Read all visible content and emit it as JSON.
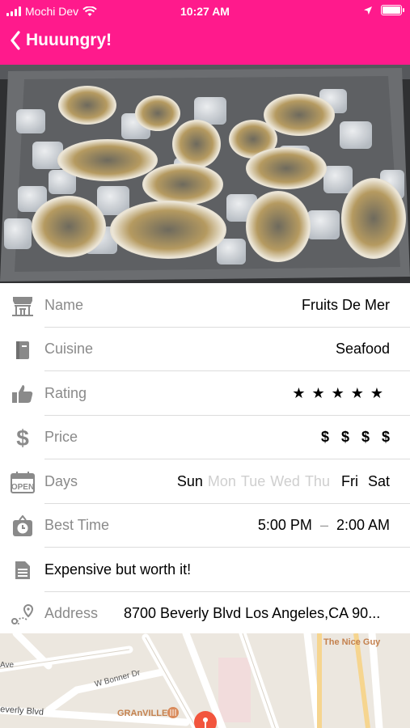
{
  "status_bar": {
    "carrier": "Mochi Dev",
    "time": "10:27 AM"
  },
  "nav": {
    "title": "Huuungry!"
  },
  "details": {
    "name_label": "Name",
    "name_value": "Fruits De Mer",
    "cuisine_label": "Cuisine",
    "cuisine_value": "Seafood",
    "rating_label": "Rating",
    "rating_stars": "★★★★★",
    "rating_value": 5,
    "price_label": "Price",
    "price_symbols": [
      "$",
      "$",
      "$",
      "$"
    ],
    "days_label": "Days",
    "days": [
      {
        "label": "Sun",
        "active": true
      },
      {
        "label": "Mon",
        "active": false
      },
      {
        "label": "Tue",
        "active": false
      },
      {
        "label": "Wed",
        "active": false
      },
      {
        "label": "Thu",
        "active": false
      },
      {
        "label": "Fri",
        "active": true
      },
      {
        "label": "Sat",
        "active": true
      }
    ],
    "best_time_label": "Best Time",
    "best_time_start": "5:00 PM",
    "best_time_sep": "–",
    "best_time_end": "2:00 AM",
    "note": "Expensive but worth it!",
    "address_label": "Address",
    "address_value": "8700 Beverly Blvd Los Angeles,CA 90..."
  },
  "map": {
    "labels": {
      "place_1": "The Nice Guy",
      "street_1": "Ave",
      "street_2": "W Bonner Dr",
      "street_3": "everly Blvd",
      "place_2": "GRAnVILLE"
    }
  },
  "colors": {
    "brand": "#ff1a8c",
    "label_gray": "#8a8a8a",
    "inactive_day": "#cfcfcf",
    "map_pin": "#f2553d",
    "map_poi": "#d98a5a"
  }
}
